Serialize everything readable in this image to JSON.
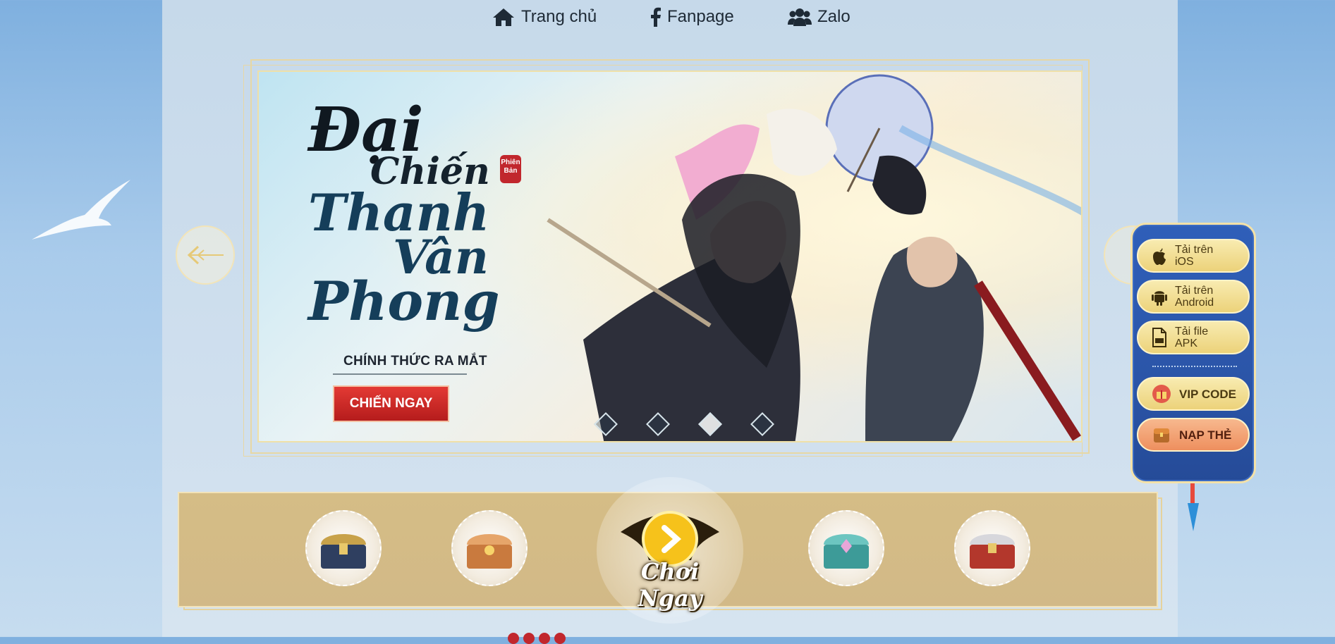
{
  "nav": {
    "home_label": "Trang chủ",
    "fanpage_label": "Fanpage",
    "zalo_label": "Zalo"
  },
  "banner": {
    "logo_lines": [
      "Đại",
      "Chiến",
      "Thanh",
      "Vân",
      "Phong"
    ],
    "badge": "Phiên Bản",
    "subtitle": "CHÍNH THỨC RA MẮT",
    "cta_label": "CHIẾN NGAY"
  },
  "side_panel": {
    "ios": [
      "Tải trên",
      "iOS"
    ],
    "android": [
      "Tải trên",
      "Android"
    ],
    "apk": [
      "Tải file",
      "APK"
    ],
    "vip_label": "VIP CODE",
    "nap_label": "NẠP THẺ"
  },
  "bottom": {
    "play_label": "Chơi Ngay"
  },
  "colors": {
    "accent_gold": "#ecd27a",
    "panel_blue": "#2b55a8",
    "cta_red": "#c1272d",
    "bottom_bar": "#d5bd86"
  }
}
